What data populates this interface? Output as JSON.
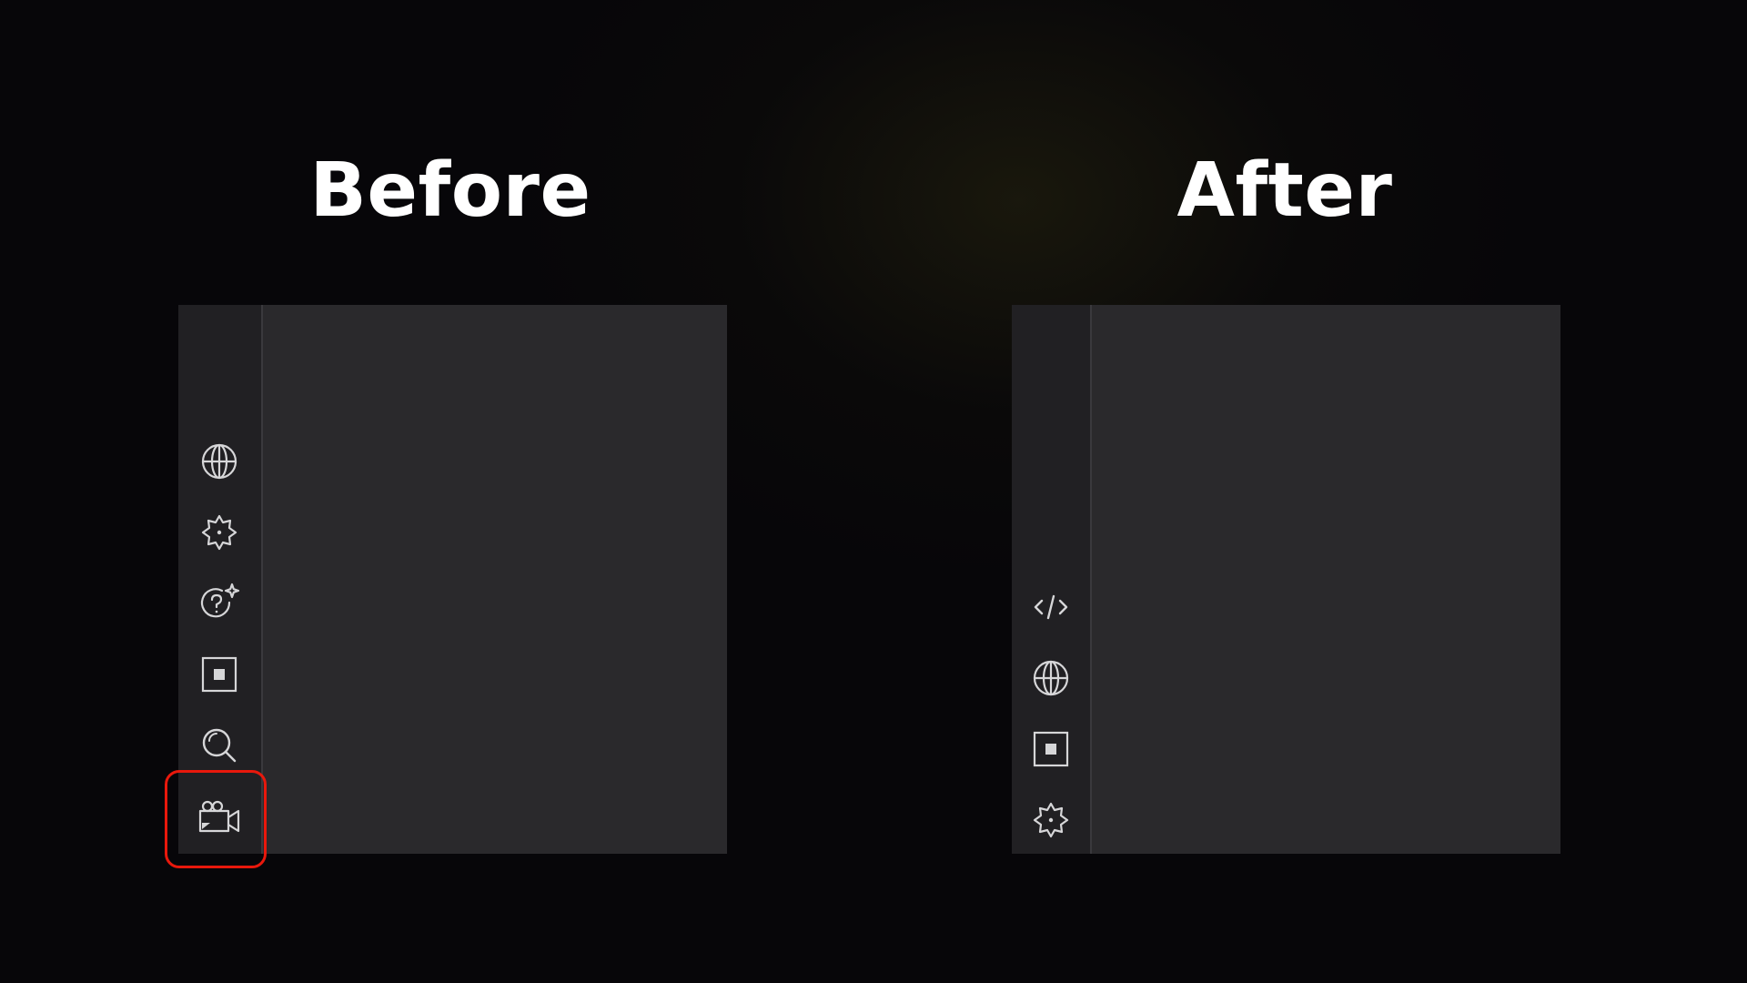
{
  "labels": {
    "before": "Before",
    "after": "After"
  },
  "before_panel": {
    "icons": [
      "globe-icon",
      "gear-icon",
      "ai-help-icon",
      "stop-square-icon",
      "search-icon",
      "camera-icon"
    ],
    "highlighted_icon": "camera-icon"
  },
  "after_panel": {
    "icons": [
      "code-icon",
      "globe-icon",
      "stop-square-icon",
      "gear-icon"
    ]
  },
  "colors": {
    "background": "#070609",
    "panel": "#2a292c",
    "rail": "#212023",
    "icon_stroke": "#d6d6d8",
    "highlight": "#e8180c",
    "heading_text": "#ffffff"
  }
}
